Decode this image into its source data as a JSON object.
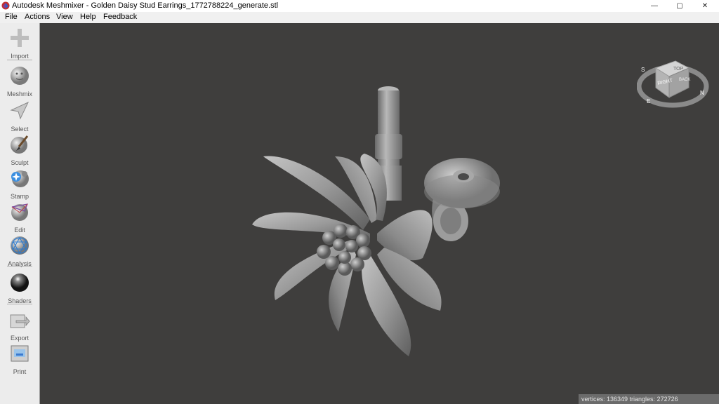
{
  "window": {
    "title": "Autodesk Meshmixer - Golden Daisy Stud Earrings_1772788224_generate.stl",
    "controls": {
      "minimize": "—",
      "maximize": "▢",
      "close": "✕"
    }
  },
  "menu": [
    "File",
    "Actions",
    "View",
    "Help",
    "Feedback"
  ],
  "tools": [
    {
      "label": "Import",
      "icon": "plus-icon"
    },
    {
      "label": "Meshmix",
      "icon": "meshmix-icon"
    },
    {
      "label": "Select",
      "icon": "select-arrow-icon"
    },
    {
      "label": "Sculpt",
      "icon": "sculpt-brush-icon"
    },
    {
      "label": "Stamp",
      "icon": "stamp-icon"
    },
    {
      "label": "Edit",
      "icon": "edit-icon"
    },
    {
      "label": "Analysis",
      "icon": "analysis-icon"
    },
    {
      "label": "Shaders",
      "icon": "shaders-icon"
    },
    {
      "label": "Export",
      "icon": "export-icon"
    },
    {
      "label": "Print",
      "icon": "print-icon"
    }
  ],
  "viewcube": {
    "top": "TOP",
    "right": "RIGHT",
    "back": "BACK",
    "compass": [
      "S",
      "E",
      "N"
    ]
  },
  "status": "vertices: 136349  triangles: 272726",
  "colors": {
    "viewport_bg": "#3f3e3d",
    "toolbar_bg": "#ececec",
    "status_bg": "#6b6b6b",
    "model": "#9a9a9a"
  }
}
